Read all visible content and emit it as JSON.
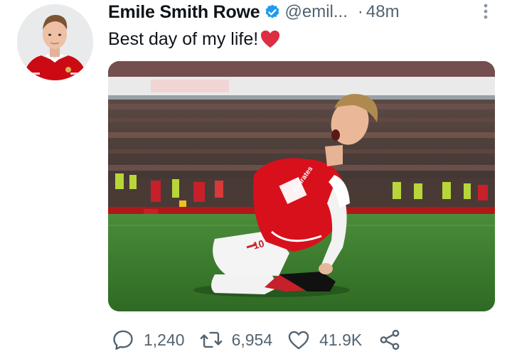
{
  "author": {
    "name": "Emile Smith Rowe",
    "handle": "@emil...",
    "separator": "·",
    "time": "48m",
    "avatar_icon": "profile-photo",
    "verified_color": "#1d9bf0"
  },
  "tweet": {
    "text": "Best day of my life!",
    "emoji": "red-heart",
    "media_icon": "football-celebration-photo"
  },
  "actions": {
    "replies": "1,240",
    "retweets": "6,954",
    "likes": "41.9K"
  },
  "colors": {
    "secondary_text": "#536471",
    "primary_text": "#0f1419",
    "arsenal_red": "#db0007",
    "pitch_green": "#3a7d2e"
  }
}
